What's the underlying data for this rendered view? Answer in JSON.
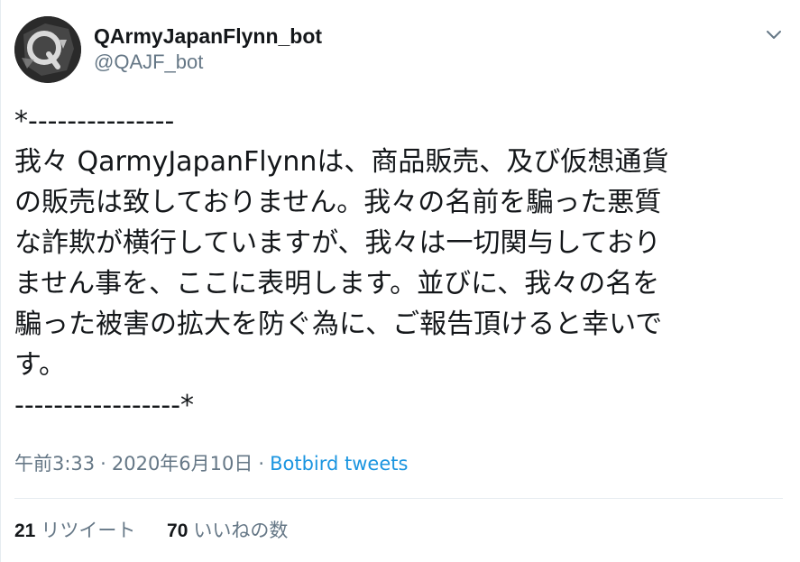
{
  "user": {
    "display_name": "QArmyJapanFlynn_bot",
    "screen_name": "@QAJF_bot",
    "avatar_icon": "q-logo-avatar"
  },
  "menu": {
    "icon": "chevron-down-icon"
  },
  "tweet": {
    "lines": [
      "*---------------",
      "我々 QarmyJapanFlynnは、商品販売、及び仮想通貨",
      "の販売は致しておりません。我々の名前を騙った悪質",
      "な詐欺が横行していますが、我々は一切関与しており",
      "ません事を、ここに表明します。並びに、我々の名を",
      "騙った被害の拡大を防ぐ為に、ご報告頂けると幸いで",
      "す。",
      "-----------------*"
    ]
  },
  "meta": {
    "time": "午前3:33",
    "separator": "·",
    "date": "2020年6月10日",
    "source": "Botbird tweets"
  },
  "stats": {
    "retweets_count": "21",
    "retweets_label": "リツイート",
    "likes_count": "70",
    "likes_label": "いいねの数"
  },
  "colors": {
    "text": "#14171a",
    "secondary": "#657786",
    "link": "#1b95e0",
    "divider": "#e6ecf0"
  }
}
